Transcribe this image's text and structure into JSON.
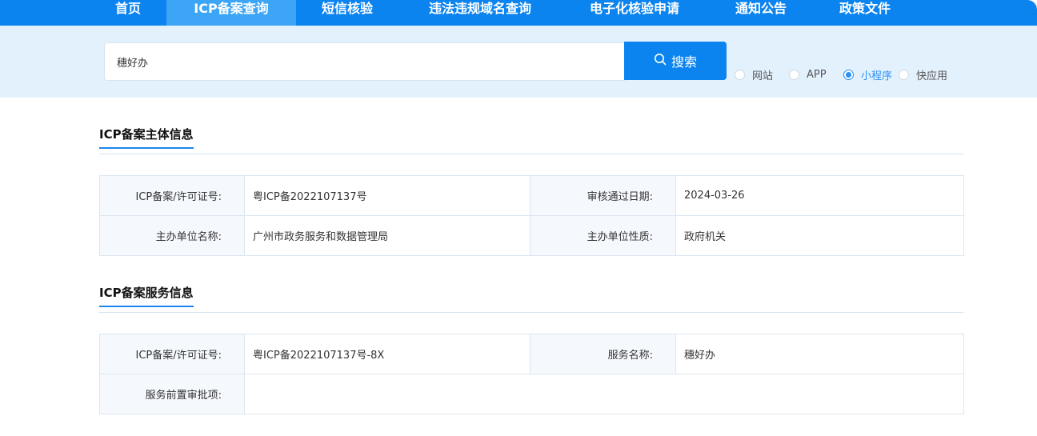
{
  "nav": {
    "items": [
      {
        "label": "首页"
      },
      {
        "label": "ICP备案查询"
      },
      {
        "label": "短信核验"
      },
      {
        "label": "违法违规域名查询"
      },
      {
        "label": "电子化核验申请"
      },
      {
        "label": "通知公告"
      },
      {
        "label": "政策文件"
      }
    ],
    "active": "ICP备案查询"
  },
  "search": {
    "value": "穗好办",
    "button_label": "搜索",
    "types": [
      {
        "label": "网站",
        "checked": false
      },
      {
        "label": "APP",
        "checked": false
      },
      {
        "label": "小程序",
        "checked": true
      },
      {
        "label": "快应用",
        "checked": false
      }
    ]
  },
  "entity": {
    "title": "ICP备案主体信息",
    "rows": [
      {
        "l1": "ICP备案/许可证号:",
        "v1": "粤ICP备2022107137号",
        "l2": "审核通过日期:",
        "v2": "2024-03-26"
      },
      {
        "l1": "主办单位名称:",
        "v1": "广州市政务服务和数据管理局",
        "l2": "主办单位性质:",
        "v2": "政府机关"
      }
    ]
  },
  "service": {
    "title": "ICP备案服务信息",
    "license_label": "ICP备案/许可证号:",
    "license_value": "粤ICP备2022107137号-8X",
    "name_label": "服务名称:",
    "name_value": "穗好办",
    "approval_label": "服务前置审批项:",
    "approval_value": ""
  },
  "colors": {
    "primary": "#0b84f0",
    "active_tab": "#3da5f6",
    "band": "#e3f1fd"
  }
}
